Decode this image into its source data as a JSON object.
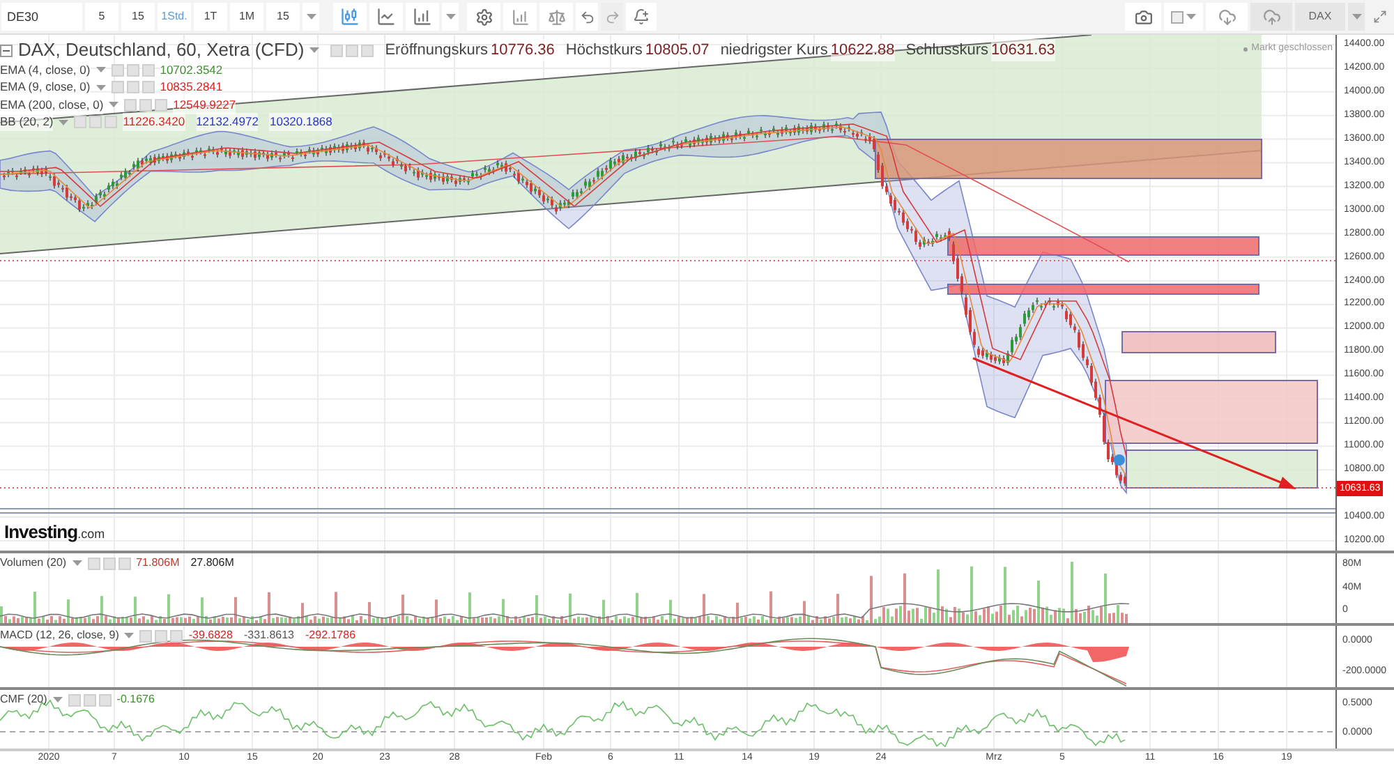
{
  "toolbar": {
    "symbol": "DE30",
    "intervals": [
      {
        "label": "5",
        "selected": false
      },
      {
        "label": "15",
        "selected": false
      },
      {
        "label": "1Std.",
        "selected": true
      },
      {
        "label": "1T",
        "selected": false
      },
      {
        "label": "1M",
        "selected": false
      },
      {
        "label": "15",
        "selected": false
      }
    ],
    "chart_types": [
      {
        "kind": "candles",
        "selected": true
      },
      {
        "kind": "line",
        "selected": false
      },
      {
        "kind": "bars",
        "selected": false
      }
    ],
    "instrument": "DAX"
  },
  "legend": {
    "title": "DAX, Deutschland, 60, Xetra (CFD)",
    "quotes": [
      {
        "label": "Eröffnungskurs",
        "value": "10776.36"
      },
      {
        "label": "Höchstkurs",
        "value": "10805.07"
      },
      {
        "label": "niedrigster Kurs",
        "value": "10622.88"
      },
      {
        "label": "Schlusskurs",
        "value": "10631.63"
      }
    ],
    "indicators": [
      {
        "name": "EMA (4, close, 0)",
        "values": [
          {
            "text": "10702.3542",
            "color": "#3f8f2f"
          }
        ]
      },
      {
        "name": "EMA (9, close, 0)",
        "values": [
          {
            "text": "10835.2841",
            "color": "#e02020"
          }
        ]
      },
      {
        "name": "EMA (200, close, 0)",
        "values": [
          {
            "text": "12549.9227",
            "color": "#e02020"
          }
        ]
      },
      {
        "name": "BB (20, 2)",
        "values": [
          {
            "text": "11226.3420",
            "color": "#e02020"
          },
          {
            "text": "12132.4972",
            "color": "#2a35c8"
          },
          {
            "text": "10320.1868",
            "color": "#2a35c8"
          }
        ]
      }
    ]
  },
  "market_status": "Markt geschlossen",
  "price_axis": {
    "ticks": [
      "14400.00",
      "14200.00",
      "14000.00",
      "13800.00",
      "13600.00",
      "13400.00",
      "13200.00",
      "13000.00",
      "12800.00",
      "12600.00",
      "12400.00",
      "12200.00",
      "12000.00",
      "11800.00",
      "11600.00",
      "11400.00",
      "11200.00",
      "11000.00",
      "10800.00",
      "10400.00",
      "10200.00"
    ],
    "last_price": "10631.63"
  },
  "logo": {
    "brand": "Investing",
    "suffix": ".com"
  },
  "panels": [
    {
      "kind": "volume",
      "label": "Volumen (20)",
      "values": [
        {
          "text": "71.806M",
          "color": "#c0392b"
        },
        {
          "text": "27.806M",
          "color": "#222222"
        }
      ],
      "ticks": [
        "80M",
        "40M",
        "0"
      ]
    },
    {
      "kind": "macd",
      "label": "MACD (12, 26, close, 9)",
      "values": [
        {
          "text": "-39.6828",
          "color": "#e02020"
        },
        {
          "text": "-331.8613",
          "color": "#555555"
        },
        {
          "text": "-292.1786",
          "color": "#e02020"
        }
      ],
      "ticks": [
        "0.0000",
        "-200.0000"
      ]
    },
    {
      "kind": "cmf",
      "label": "CMF (20)",
      "values": [
        {
          "text": "-0.1676",
          "color": "#3f8f2f"
        }
      ],
      "ticks": [
        "0.5000",
        "0.0000"
      ]
    }
  ],
  "time_axis": [
    "2020",
    "7",
    "10",
    "15",
    "20",
    "23",
    "28",
    "Feb",
    "6",
    "11",
    "14",
    "19",
    "24",
    "Mrz",
    "5",
    "11",
    "16",
    "19"
  ]
}
